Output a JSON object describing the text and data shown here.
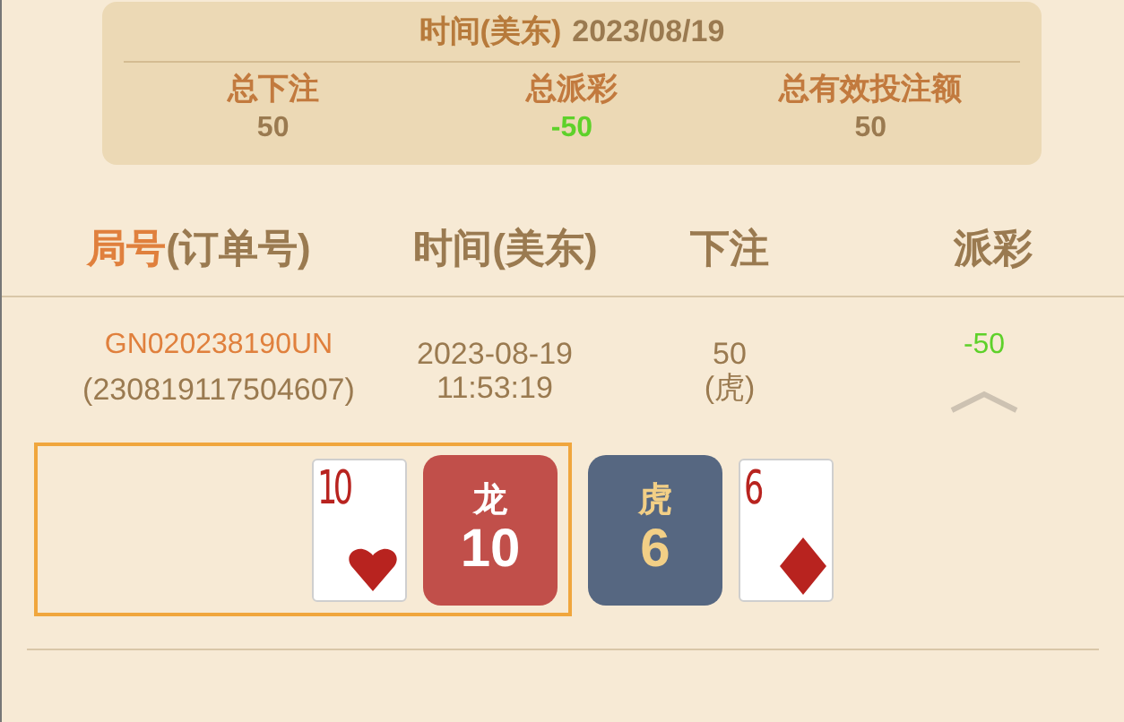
{
  "summary": {
    "date_label": "时间(美东)",
    "date": "2023/08/19",
    "stats": [
      {
        "label": "总下注",
        "value": "50",
        "color": "#9a7a50"
      },
      {
        "label": "总派彩",
        "value": "-50",
        "color": "#5ed12a"
      },
      {
        "label": "总有效投注额",
        "value": "50",
        "color": "#9a7a50"
      }
    ]
  },
  "columns": [
    {
      "label": "局号",
      "sub": "(订单号)"
    },
    {
      "label": "时间(美东)"
    },
    {
      "label": "下注"
    },
    {
      "label": "派彩"
    }
  ],
  "rows": [
    {
      "round_id": "GN020238190UN",
      "order_no": "(230819117504607)",
      "date": "2023-08-19",
      "time": "11:53:19",
      "bet": "50",
      "bet_side": "(虎)",
      "payout": "-50",
      "expanded": true,
      "result": [
        {
          "name": "龙",
          "score": "10",
          "selected": true,
          "card": {
            "rank": "10",
            "kind": "hearts"
          }
        },
        {
          "name": "虎",
          "score": "6",
          "selected": false,
          "card": {
            "rank": "6",
            "kind": "diamonds"
          }
        }
      ]
    }
  ]
}
